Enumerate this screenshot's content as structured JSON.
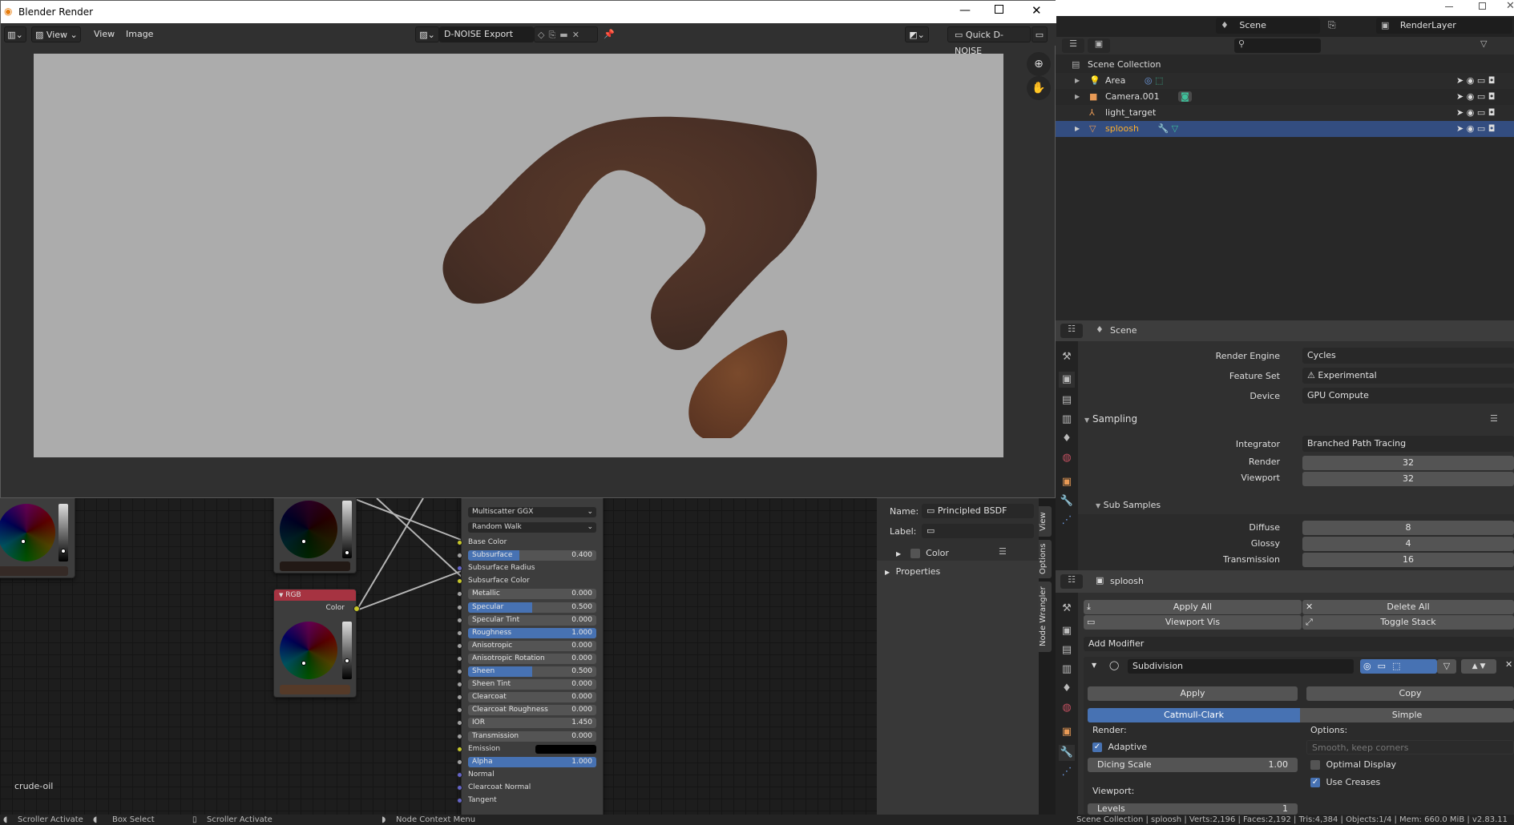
{
  "window": {
    "title": "Blender Render",
    "controls": {
      "minimize": "minimize-icon",
      "maximize": "maximize-icon",
      "close": "close-icon"
    }
  },
  "image_editor": {
    "header": {
      "editor_type_icon": "image-editor-icon",
      "view_mode": "View",
      "menus": [
        "View",
        "Image"
      ],
      "image_name": "D-NOISE Export",
      "quick_denoise_label": "Quick D-NOISE"
    },
    "nav_icons": [
      "zoom-in-icon",
      "hand-pan-icon"
    ]
  },
  "top_right": {
    "scene": "Scene",
    "render_layer": "RenderLayer"
  },
  "outliner": {
    "search_placeholder": "",
    "root": "Scene Collection",
    "items": [
      {
        "name": "Area",
        "type": "light",
        "selected": false
      },
      {
        "name": "Camera.001",
        "type": "camera",
        "selected": false
      },
      {
        "name": "light_target",
        "type": "empty",
        "selected": false
      },
      {
        "name": "sploosh",
        "type": "mesh",
        "selected": true
      }
    ]
  },
  "render_props": {
    "context": "Scene",
    "render_engine_label": "Render Engine",
    "render_engine": "Cycles",
    "feature_set_label": "Feature Set",
    "feature_set": "Experimental",
    "device_label": "Device",
    "device": "GPU Compute",
    "sampling_title": "Sampling",
    "integrator_label": "Integrator",
    "integrator": "Branched Path Tracing",
    "render_label": "Render",
    "render_samples": "32",
    "viewport_label": "Viewport",
    "viewport_samples": "32",
    "sub_samples_title": "Sub Samples",
    "diffuse_label": "Diffuse",
    "diffuse": "8",
    "glossy_label": "Glossy",
    "glossy": "4",
    "transmission_label": "Transmission",
    "transmission": "16"
  },
  "modifier_props": {
    "context": "sploosh",
    "apply_all": "Apply All",
    "delete_all": "Delete All",
    "viewport_vis": "Viewport Vis",
    "toggle_stack": "Toggle Stack",
    "add_modifier": "Add Modifier",
    "modifier_name": "Subdivision",
    "apply": "Apply",
    "copy": "Copy",
    "catmull_clark": "Catmull-Clark",
    "simple": "Simple",
    "render_heading": "Render:",
    "adaptive_label": "Adaptive",
    "adaptive": true,
    "dicing_scale_label": "Dicing Scale",
    "dicing_scale": "1.00",
    "viewport_heading": "Viewport:",
    "levels_label": "Levels",
    "levels": "1",
    "options_heading": "Options:",
    "uv_smooth": "Smooth, keep corners",
    "optimal_display_label": "Optimal Display",
    "optimal_display": false,
    "use_creases_label": "Use Creases",
    "use_creases": true
  },
  "node_editor": {
    "material_name": "crude-oil",
    "rgb_node_title": "RGB",
    "rgb_output": "Color",
    "bsdf": {
      "distribution": "Multiscatter GGX",
      "subsurface_method": "Random Walk",
      "inputs": [
        {
          "label": "Base Color",
          "kind": "socket",
          "socket": "yellow"
        },
        {
          "label": "Subsurface",
          "kind": "slider",
          "value": "0.400",
          "fraction": 0.4
        },
        {
          "label": "Subsurface Radius",
          "kind": "socket",
          "socket": "blue"
        },
        {
          "label": "Subsurface Color",
          "kind": "socket",
          "socket": "yellow"
        },
        {
          "label": "Metallic",
          "kind": "slider",
          "value": "0.000",
          "fraction": 0
        },
        {
          "label": "Specular",
          "kind": "slider",
          "value": "0.500",
          "fraction": 0.5
        },
        {
          "label": "Specular Tint",
          "kind": "slider",
          "value": "0.000",
          "fraction": 0
        },
        {
          "label": "Roughness",
          "kind": "slider",
          "value": "1.000",
          "fraction": 1
        },
        {
          "label": "Anisotropic",
          "kind": "slider",
          "value": "0.000",
          "fraction": 0
        },
        {
          "label": "Anisotropic Rotation",
          "kind": "slider",
          "value": "0.000",
          "fraction": 0
        },
        {
          "label": "Sheen",
          "kind": "slider",
          "value": "0.500",
          "fraction": 0.5
        },
        {
          "label": "Sheen Tint",
          "kind": "slider",
          "value": "0.000",
          "fraction": 0
        },
        {
          "label": "Clearcoat",
          "kind": "slider",
          "value": "0.000",
          "fraction": 0
        },
        {
          "label": "Clearcoat Roughness",
          "kind": "slider",
          "value": "0.000",
          "fraction": 0
        },
        {
          "label": "IOR",
          "kind": "slider",
          "value": "1.450",
          "fraction": 0
        },
        {
          "label": "Transmission",
          "kind": "slider",
          "value": "0.000",
          "fraction": 0
        },
        {
          "label": "Emission",
          "kind": "color",
          "color": "#000000",
          "socket": "yellow"
        },
        {
          "label": "Alpha",
          "kind": "slider",
          "value": "1.000",
          "fraction": 1
        },
        {
          "label": "Normal",
          "kind": "socket",
          "socket": "blue"
        },
        {
          "label": "Clearcoat Normal",
          "kind": "socket",
          "socket": "blue"
        },
        {
          "label": "Tangent",
          "kind": "socket",
          "socket": "blue"
        }
      ]
    },
    "sidebar": {
      "name_label": "Name:",
      "name_value": "Principled BSDF",
      "label_label": "Label:",
      "label_value": "",
      "color_label": "Color",
      "properties_label": "Properties",
      "tabs": [
        "View",
        "Options",
        "Node Wrangler"
      ]
    }
  },
  "statusbar": {
    "hints": [
      "Scroller Activate",
      "Box Select",
      "Scroller Activate",
      "Node Context Menu"
    ],
    "info": "Scene Collection | sploosh | Verts:2,196 | Faces:2,192 | Tris:4,384 | Objects:1/4 | Mem: 660.0 MiB | v2.83.11"
  },
  "colors": {
    "accent": "#4772b3",
    "selection": "#334d80",
    "rgb_header": "#a63341",
    "object_orange": "#e89a56"
  }
}
